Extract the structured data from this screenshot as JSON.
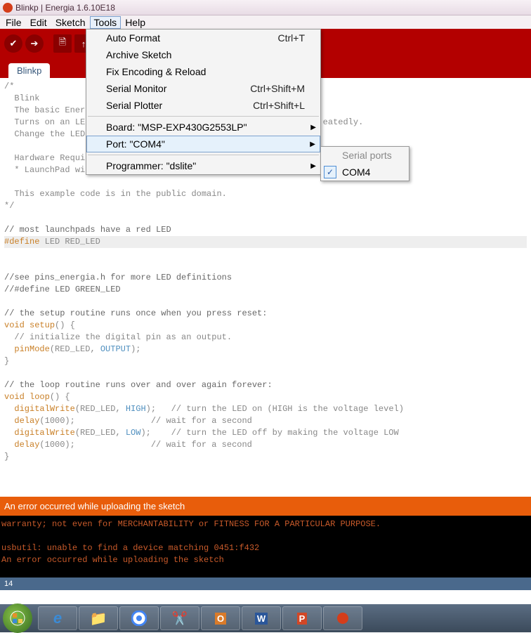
{
  "window": {
    "title": "Blinkp | Energia 1.6.10E18"
  },
  "menubar": {
    "file": "File",
    "edit": "Edit",
    "sketch": "Sketch",
    "tools": "Tools",
    "help": "Help"
  },
  "toolbar": {
    "verify": "✓",
    "upload": "→",
    "new": "▦",
    "open": "↑",
    "save": "↓"
  },
  "tab": {
    "name": "Blinkp"
  },
  "tools_menu": {
    "auto_format": {
      "label": "Auto Format",
      "shortcut": "Ctrl+T"
    },
    "archive": {
      "label": "Archive Sketch"
    },
    "fix_enc": {
      "label": "Fix Encoding & Reload"
    },
    "serial_monitor": {
      "label": "Serial Monitor",
      "shortcut": "Ctrl+Shift+M"
    },
    "serial_plotter": {
      "label": "Serial Plotter",
      "shortcut": "Ctrl+Shift+L"
    },
    "board": {
      "label": "Board: \"MSP-EXP430G2553LP\""
    },
    "port": {
      "label": "Port: \"COM4\""
    },
    "programmer": {
      "label": "Programmer: \"dslite\""
    }
  },
  "port_submenu": {
    "header": "Serial ports",
    "item": "COM4"
  },
  "code": {
    "l1": "/*",
    "l2": "  Blink",
    "l3": "  The basic Ener",
    "l4": "  Turns on an LE                                               eatedly.",
    "l5": "  Change the LED",
    "l6": "",
    "l7": "  Hardware Requi",
    "l8": "  * LaunchPad wi",
    "l9": "",
    "l10": "  This example code is in the public domain.",
    "l11": "*/",
    "l12": "",
    "l13": "// most launchpads have a red LED",
    "l14a": "#define",
    " l14b": " LED RED_LED",
    "l15": "",
    "l16": "//see pins_energia.h for more LED definitions",
    "l17": "//#define LED GREEN_LED",
    "l18": "",
    "l19": "// the setup routine runs once when you press reset:",
    "l20a": "void",
    "l20b": " ",
    "l20c": "setup",
    "l20d": "() {",
    "l21": "  // initialize the digital pin as an output.",
    "l22a": "  ",
    "l22b": "pinMode",
    "l22c": "(RED_LED, ",
    "l22d": "OUTPUT",
    "l22e": ");",
    "l23": "}",
    "l24": "",
    "l25": "// the loop routine runs over and over again forever:",
    "l26a": "void",
    "l26b": " ",
    "l26c": "loop",
    "l26d": "() {",
    "l27a": "  ",
    "l27b": "digitalWrite",
    "l27c": "(RED_LED, ",
    "l27d": "HIGH",
    "l27e": ");   // turn the LED on (HIGH is the voltage level)",
    "l28a": "  ",
    "l28b": "delay",
    "l28c": "(1000);               // wait for a second",
    "l29a": "  ",
    "l29b": "digitalWrite",
    "l29c": "(RED_LED, ",
    "l29d": "LOW",
    "l29e": ");    // turn the LED off by making the voltage LOW",
    "l30a": "  ",
    "l30b": "delay",
    "l30c": "(1000);               // wait for a second",
    "l31": "}"
  },
  "errorbar": {
    "msg": "An error occurred while uploading the sketch"
  },
  "console": {
    "l1": "warranty; not even for MERCHANTABILITY or FITNESS FOR A PARTICULAR PURPOSE.",
    "l2": "",
    "l3": "usbutil: unable to find a device matching 0451:f432",
    "l4": "An error occurred while uploading the sketch"
  },
  "status": {
    "line": "14"
  }
}
